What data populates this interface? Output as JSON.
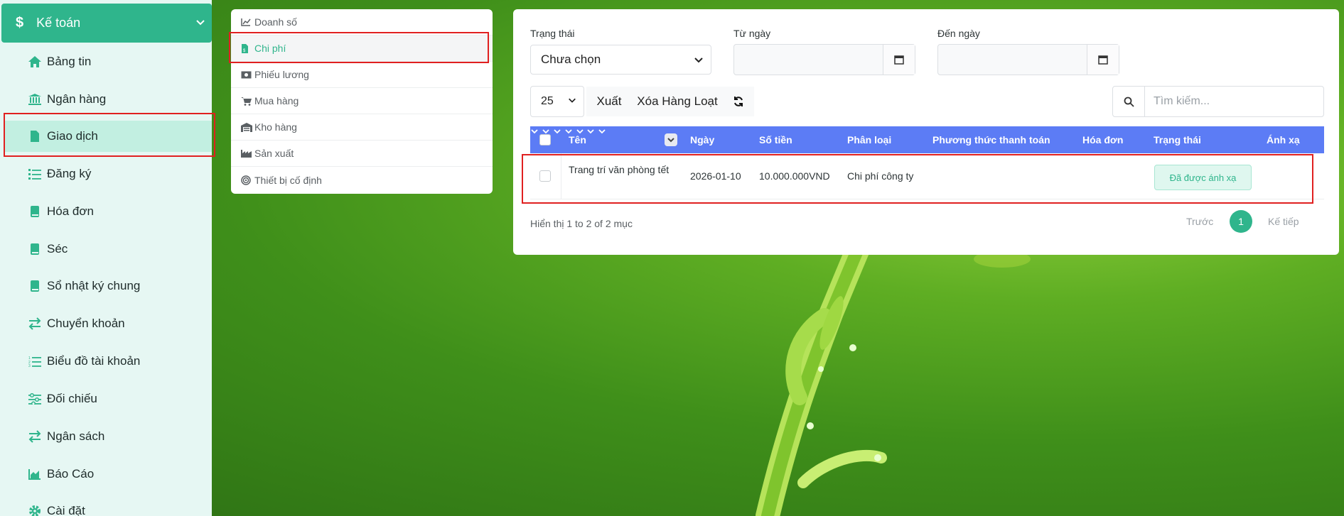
{
  "sidebar": {
    "header": "Kế toán",
    "items": [
      {
        "label": "Bảng tin"
      },
      {
        "label": "Ngân hàng"
      },
      {
        "label": "Giao dịch"
      },
      {
        "label": "Đăng ký"
      },
      {
        "label": "Hóa đơn"
      },
      {
        "label": "Séc"
      },
      {
        "label": "Sổ nhật ký chung"
      },
      {
        "label": "Chuyển khoản"
      },
      {
        "label": "Biểu đồ tài khoản"
      },
      {
        "label": "Đối chiếu"
      },
      {
        "label": "Ngân sách"
      },
      {
        "label": "Báo Cáo"
      },
      {
        "label": "Cài đặt"
      }
    ],
    "active_index": 2
  },
  "submenu": {
    "items": [
      {
        "label": "Doanh số",
        "icon": "chart-line-icon"
      },
      {
        "label": "Chi phí",
        "icon": "file-invoice-icon"
      },
      {
        "label": "Phiếu lương",
        "icon": "money-bill-icon"
      },
      {
        "label": "Mua hàng",
        "icon": "cart-icon"
      },
      {
        "label": "Kho hàng",
        "icon": "warehouse-icon"
      },
      {
        "label": "Sản xuất",
        "icon": "industry-icon"
      },
      {
        "label": "Thiết bị cố định",
        "icon": "bullseye-icon"
      }
    ],
    "active_index": 1
  },
  "filters": {
    "status_label": "Trạng thái",
    "status_value": "Chưa chọn",
    "from_label": "Từ ngày",
    "to_label": "Đến ngày"
  },
  "toolbar": {
    "page_size": "25",
    "export_label": "Xuất",
    "bulk_delete_label": "Xóa Hàng Loạt",
    "search_placeholder": "Tìm kiếm..."
  },
  "table": {
    "columns": [
      "Tên",
      "Ngày",
      "Số tiền",
      "Phân loại",
      "Phương thức thanh toán",
      "Hóa đơn",
      "Trạng thái",
      "Ánh xạ"
    ],
    "rows": [
      {
        "name": "Trang trí văn phòng tết",
        "date": "2026-01-10",
        "amount": "10.000.000VND",
        "category": "Chi phí công ty",
        "payment_method": "",
        "invoice": "",
        "status": "Đã được ánh xạ",
        "mapping": ""
      }
    ]
  },
  "footer": {
    "info": "Hiển thị 1 to 2 of 2 mục",
    "prev": "Trước",
    "page": "1",
    "next": "Kế tiếp"
  },
  "colors": {
    "accent": "#2fb58c",
    "table_header": "#5c7cf5",
    "highlight": "#e02020"
  }
}
